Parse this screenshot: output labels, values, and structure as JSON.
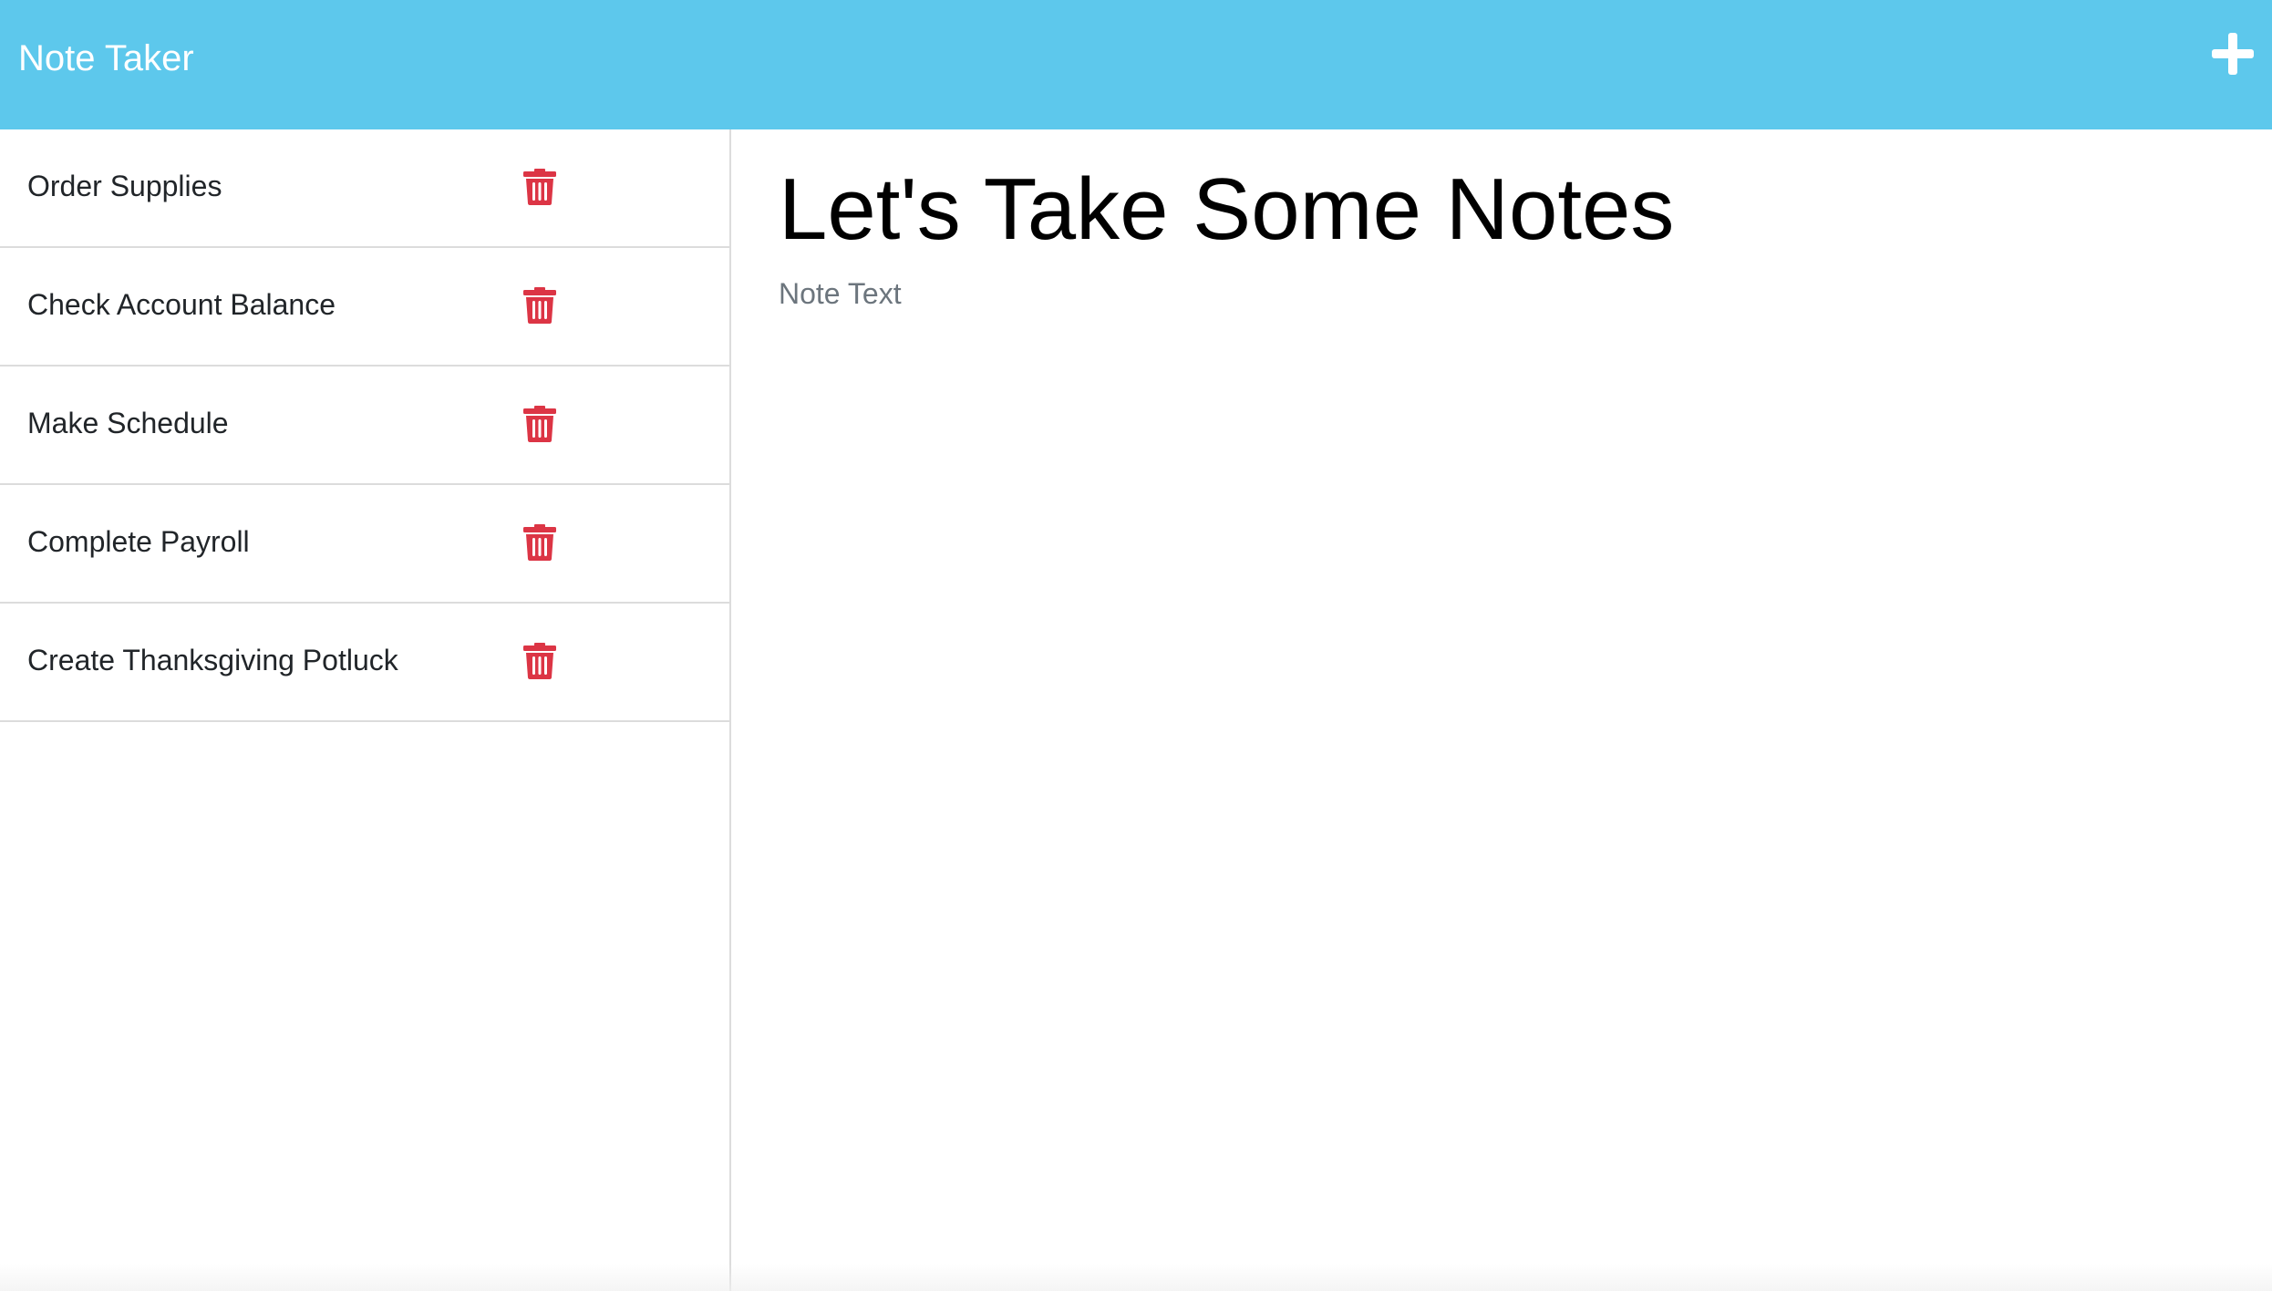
{
  "header": {
    "brand": "Note Taker",
    "new_note_icon": "plus-icon",
    "background_color": "#5dc8ec"
  },
  "sidebar": {
    "items": [
      {
        "label": "Order Supplies",
        "delete_icon": "trash-icon"
      },
      {
        "label": "Check Account Balance",
        "delete_icon": "trash-icon"
      },
      {
        "label": "Make Schedule",
        "delete_icon": "trash-icon"
      },
      {
        "label": "Complete Payroll",
        "delete_icon": "trash-icon"
      },
      {
        "label": "Create Thanksgiving Potluck",
        "delete_icon": "trash-icon"
      }
    ],
    "delete_icon_color": "#dc3545"
  },
  "editor": {
    "title_placeholder": "Let's Take Some Notes",
    "text_placeholder": "Note Text"
  }
}
